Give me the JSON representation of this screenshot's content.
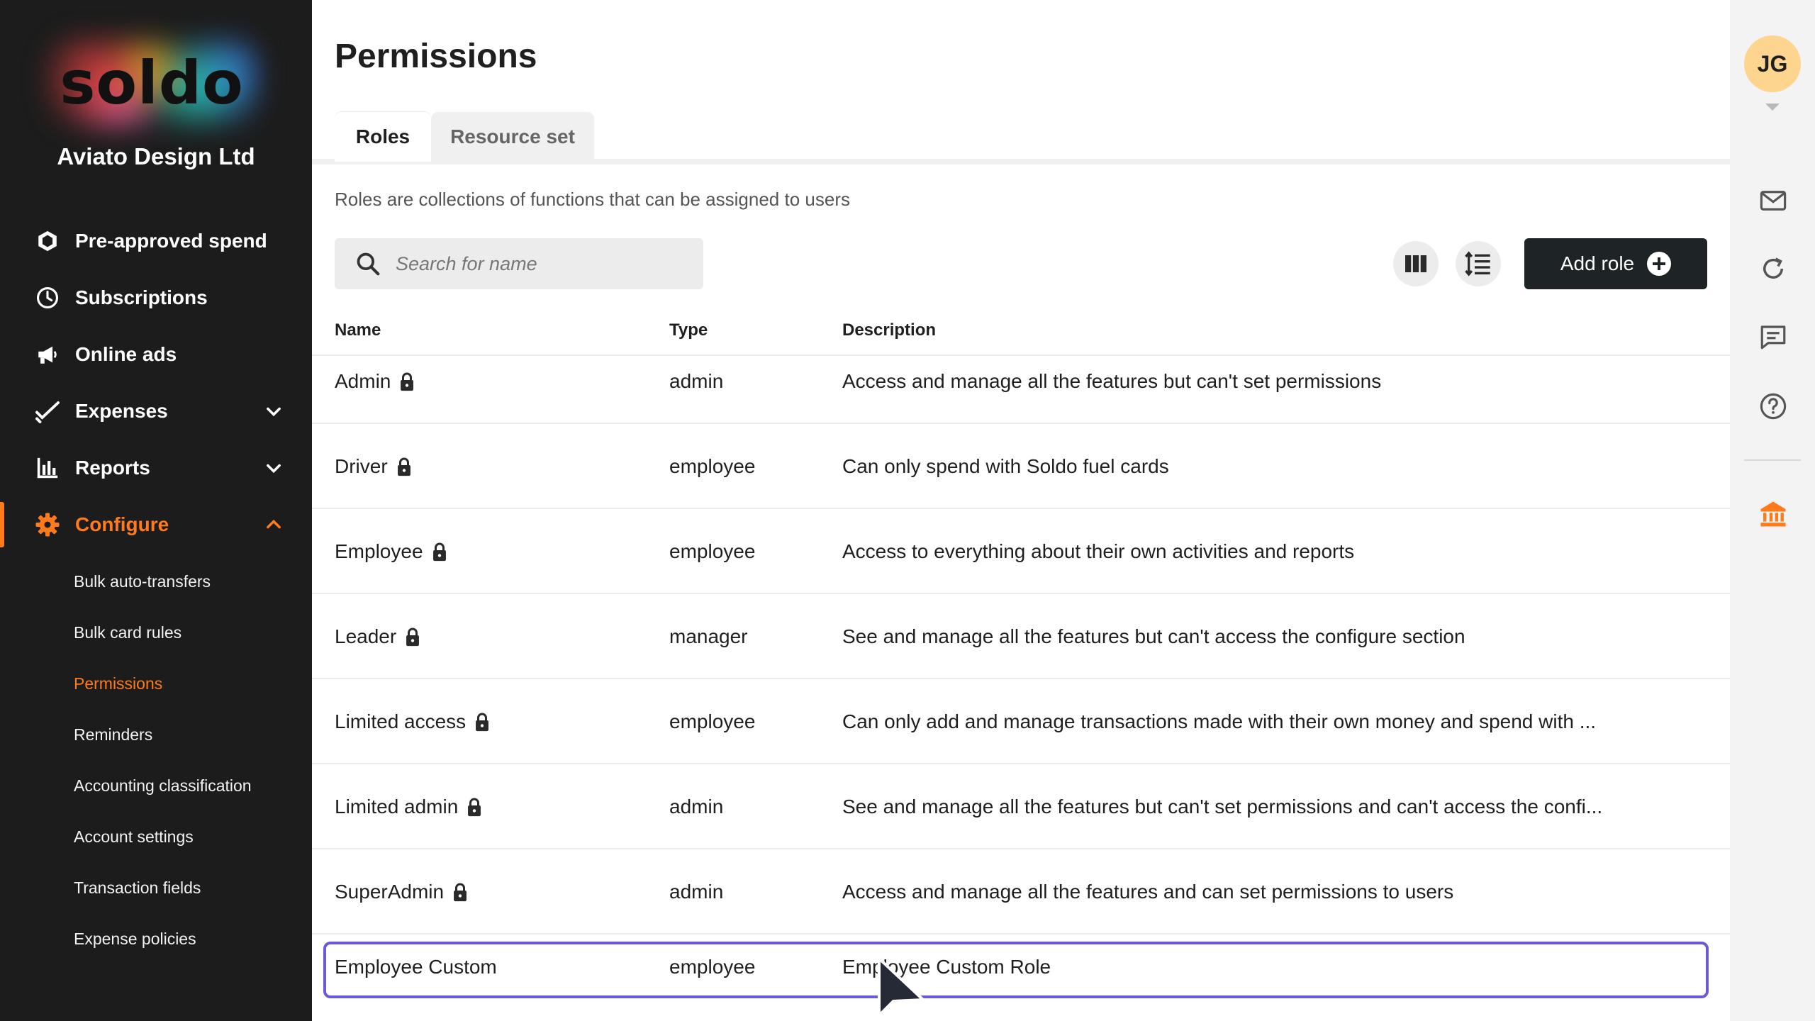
{
  "sidebar": {
    "logo_text": "soldo",
    "company": "Aviato Design Ltd",
    "items": [
      {
        "label": "Pre-approved spend",
        "icon": "hexagon-icon"
      },
      {
        "label": "Subscriptions",
        "icon": "clock-icon"
      },
      {
        "label": "Online ads",
        "icon": "megaphone-icon"
      },
      {
        "label": "Expenses",
        "icon": "checkmark-icon",
        "expandable": true
      },
      {
        "label": "Reports",
        "icon": "bar-chart-icon",
        "expandable": true
      },
      {
        "label": "Configure",
        "icon": "gear-icon",
        "expandable": true,
        "expanded": true,
        "active": true
      }
    ],
    "configure_items": [
      {
        "label": "Bulk auto-transfers"
      },
      {
        "label": "Bulk card rules"
      },
      {
        "label": "Permissions",
        "active": true
      },
      {
        "label": "Reminders"
      },
      {
        "label": "Accounting classification"
      },
      {
        "label": "Account settings"
      },
      {
        "label": "Transaction fields"
      },
      {
        "label": "Expense policies"
      }
    ],
    "accent_color": "#ff7a1a"
  },
  "header": {
    "title": "Permissions",
    "tabs": [
      {
        "label": "Roles",
        "active": true
      },
      {
        "label": "Resource set",
        "active": false
      }
    ],
    "intro": "Roles are collections of functions that can be assigned to users"
  },
  "toolbar": {
    "search_placeholder": "Search for name",
    "add_role_label": "Add role"
  },
  "table": {
    "columns": [
      "Name",
      "Type",
      "Description"
    ],
    "rows": [
      {
        "name": "Admin",
        "locked": true,
        "type": "admin",
        "description": "Access and manage all the features but can't set permissions"
      },
      {
        "name": "Driver",
        "locked": true,
        "type": "employee",
        "description": "Can only spend with Soldo fuel cards"
      },
      {
        "name": "Employee",
        "locked": true,
        "type": "employee",
        "description": "Access to everything about their own activities and reports"
      },
      {
        "name": "Leader",
        "locked": true,
        "type": "manager",
        "description": "See and manage all the features but can't access the configure section"
      },
      {
        "name": "Limited access",
        "locked": true,
        "type": "employee",
        "description": "Can only add and manage transactions made with their own money and spend with ..."
      },
      {
        "name": "Limited admin",
        "locked": true,
        "type": "admin",
        "description": "See and manage all the features but can't set permissions and can't access the confi..."
      },
      {
        "name": "SuperAdmin",
        "locked": true,
        "type": "admin",
        "description": "Access and manage all the features and can set permissions to users"
      },
      {
        "name": "Employee Custom",
        "locked": false,
        "type": "employee",
        "description": "Employee Custom Role",
        "highlighted": true
      }
    ]
  },
  "rail": {
    "avatar_initials": "JG",
    "avatar_color": "#fdd58f",
    "icons": [
      "mail-icon",
      "refresh-icon",
      "chat-icon",
      "help-icon",
      "bank-icon"
    ]
  }
}
